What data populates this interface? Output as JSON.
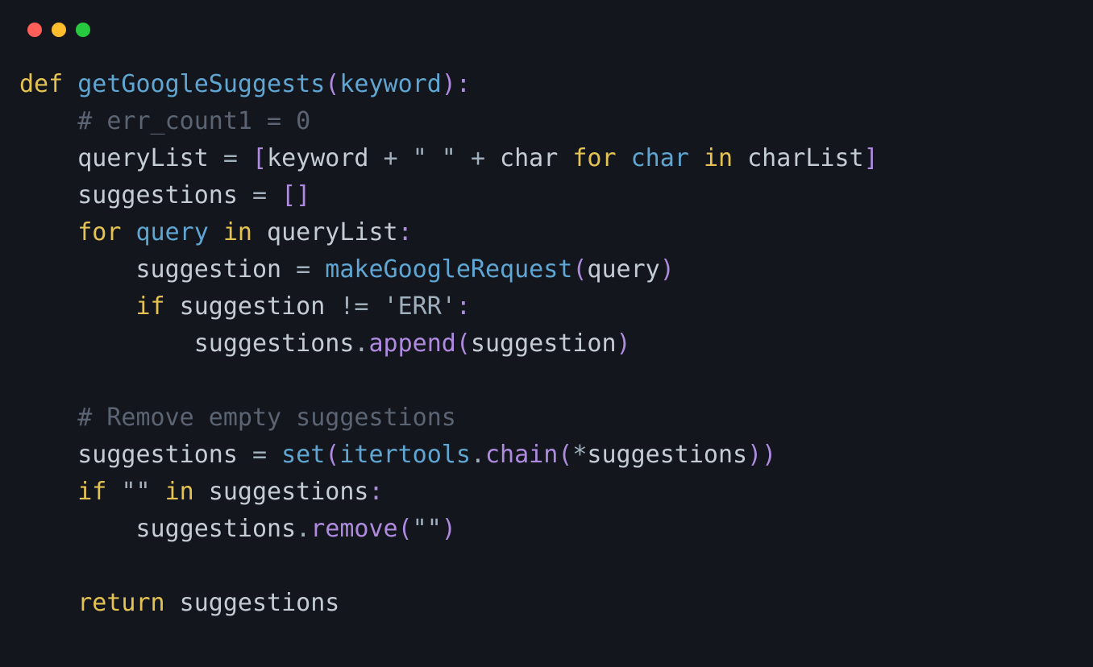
{
  "window": {
    "traffic_lights": {
      "close": {
        "color": "#ff5f56"
      },
      "minimize": {
        "color": "#ffbd2e"
      },
      "maximize": {
        "color": "#27c93f"
      }
    }
  },
  "colors": {
    "background": "#14161e",
    "keyword_yellow": "#e5c352",
    "identifier_blue": "#5fa6d3",
    "bracket_purple": "#ae8bdf",
    "default_fg": "#c4cdd4",
    "operator_grey": "#9fb0bc",
    "comment_grey": "#5a6472"
  },
  "code": {
    "language": "python",
    "raw": "def getGoogleSuggests(keyword):\n    # err_count1 = 0\n    queryList = [keyword + \" \" + char for char in charList]\n    suggestions = []\n    for query in queryList:\n        suggestion = makeGoogleRequest(query)\n        if suggestion != 'ERR':\n            suggestions.append(suggestion)\n\n    # Remove empty suggestions\n    suggestions = set(itertools.chain(*suggestions))\n    if \"\" in suggestions:\n        suggestions.remove(\"\")\n\n    return suggestions",
    "lines": [
      [
        {
          "cls": "kw1",
          "t": "def"
        },
        {
          "cls": "ident",
          "t": " "
        },
        {
          "cls": "func",
          "t": "getGoogleSuggests"
        },
        {
          "cls": "paren",
          "t": "("
        },
        {
          "cls": "param",
          "t": "keyword"
        },
        {
          "cls": "paren",
          "t": "):"
        }
      ],
      [
        {
          "cls": "ident",
          "t": "    "
        },
        {
          "cls": "com",
          "t": "# err_count1 = 0"
        }
      ],
      [
        {
          "cls": "ident",
          "t": "    queryList "
        },
        {
          "cls": "op",
          "t": "="
        },
        {
          "cls": "ident",
          "t": " "
        },
        {
          "cls": "paren",
          "t": "["
        },
        {
          "cls": "ident",
          "t": "keyword "
        },
        {
          "cls": "op",
          "t": "+"
        },
        {
          "cls": "ident",
          "t": " "
        },
        {
          "cls": "str",
          "t": "\" \""
        },
        {
          "cls": "ident",
          "t": " "
        },
        {
          "cls": "op",
          "t": "+"
        },
        {
          "cls": "ident",
          "t": " char "
        },
        {
          "cls": "kw2",
          "t": "for"
        },
        {
          "cls": "ident",
          "t": " "
        },
        {
          "cls": "param",
          "t": "char"
        },
        {
          "cls": "ident",
          "t": " "
        },
        {
          "cls": "kw2",
          "t": "in"
        },
        {
          "cls": "ident",
          "t": " charList"
        },
        {
          "cls": "paren",
          "t": "]"
        }
      ],
      [
        {
          "cls": "ident",
          "t": "    suggestions "
        },
        {
          "cls": "op",
          "t": "="
        },
        {
          "cls": "ident",
          "t": " "
        },
        {
          "cls": "paren",
          "t": "[]"
        }
      ],
      [
        {
          "cls": "ident",
          "t": "    "
        },
        {
          "cls": "kw2",
          "t": "for"
        },
        {
          "cls": "ident",
          "t": " "
        },
        {
          "cls": "param",
          "t": "query"
        },
        {
          "cls": "ident",
          "t": " "
        },
        {
          "cls": "kw2",
          "t": "in"
        },
        {
          "cls": "ident",
          "t": " queryList"
        },
        {
          "cls": "paren",
          "t": ":"
        }
      ],
      [
        {
          "cls": "ident",
          "t": "        suggestion "
        },
        {
          "cls": "op",
          "t": "="
        },
        {
          "cls": "ident",
          "t": " "
        },
        {
          "cls": "call",
          "t": "makeGoogleRequest"
        },
        {
          "cls": "paren",
          "t": "("
        },
        {
          "cls": "ident",
          "t": "query"
        },
        {
          "cls": "paren",
          "t": ")"
        }
      ],
      [
        {
          "cls": "ident",
          "t": "        "
        },
        {
          "cls": "kw2",
          "t": "if"
        },
        {
          "cls": "ident",
          "t": " suggestion "
        },
        {
          "cls": "op",
          "t": "!="
        },
        {
          "cls": "ident",
          "t": " "
        },
        {
          "cls": "str",
          "t": "'ERR'"
        },
        {
          "cls": "paren",
          "t": ":"
        }
      ],
      [
        {
          "cls": "ident",
          "t": "            suggestions"
        },
        {
          "cls": "op",
          "t": "."
        },
        {
          "cls": "meth",
          "t": "append"
        },
        {
          "cls": "paren",
          "t": "("
        },
        {
          "cls": "ident",
          "t": "suggestion"
        },
        {
          "cls": "paren",
          "t": ")"
        }
      ],
      [
        {
          "cls": "ident",
          "t": ""
        }
      ],
      [
        {
          "cls": "ident",
          "t": "    "
        },
        {
          "cls": "com",
          "t": "# Remove empty suggestions"
        }
      ],
      [
        {
          "cls": "ident",
          "t": "    suggestions "
        },
        {
          "cls": "op",
          "t": "="
        },
        {
          "cls": "ident",
          "t": " "
        },
        {
          "cls": "call",
          "t": "set"
        },
        {
          "cls": "paren",
          "t": "("
        },
        {
          "cls": "call",
          "t": "itertools"
        },
        {
          "cls": "op",
          "t": "."
        },
        {
          "cls": "meth",
          "t": "chain"
        },
        {
          "cls": "paren",
          "t": "("
        },
        {
          "cls": "op",
          "t": "*"
        },
        {
          "cls": "ident",
          "t": "suggestions"
        },
        {
          "cls": "paren",
          "t": "))"
        }
      ],
      [
        {
          "cls": "ident",
          "t": "    "
        },
        {
          "cls": "kw2",
          "t": "if"
        },
        {
          "cls": "ident",
          "t": " "
        },
        {
          "cls": "str",
          "t": "\"\""
        },
        {
          "cls": "ident",
          "t": " "
        },
        {
          "cls": "kw2",
          "t": "in"
        },
        {
          "cls": "ident",
          "t": " suggestions"
        },
        {
          "cls": "paren",
          "t": ":"
        }
      ],
      [
        {
          "cls": "ident",
          "t": "        suggestions"
        },
        {
          "cls": "op",
          "t": "."
        },
        {
          "cls": "meth",
          "t": "remove"
        },
        {
          "cls": "paren",
          "t": "("
        },
        {
          "cls": "str",
          "t": "\"\""
        },
        {
          "cls": "paren",
          "t": ")"
        }
      ],
      [
        {
          "cls": "ident",
          "t": ""
        }
      ],
      [
        {
          "cls": "ident",
          "t": "    "
        },
        {
          "cls": "kw2",
          "t": "return"
        },
        {
          "cls": "ident",
          "t": " suggestions"
        }
      ]
    ]
  }
}
